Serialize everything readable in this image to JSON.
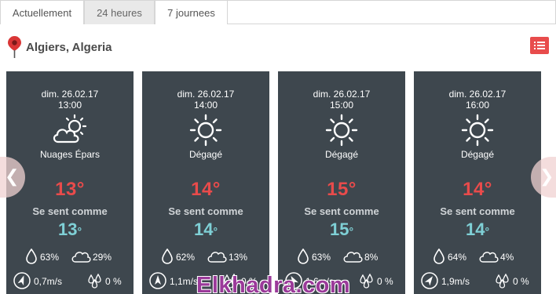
{
  "tabs": [
    {
      "label": "Actuellement"
    },
    {
      "label": "24 heures"
    },
    {
      "label": "7 journees"
    }
  ],
  "location": {
    "name": "Algiers, Algeria",
    "icon": "map-pin-icon"
  },
  "list_button": {
    "icon": "list-icon",
    "color": "#e84c4c"
  },
  "colors": {
    "card_bg": "#3e474e",
    "temp": "#e94b4b",
    "feels": "#7fd0d6"
  },
  "cards": [
    {
      "date": "dim. 26.02.17",
      "time": "13:00",
      "icon": "partly-cloudy-icon",
      "condition": "Nuages Épars",
      "temp": "13°",
      "feels_label": "Se sent comme",
      "feels_value": "13",
      "feels_unit": "°",
      "humidity": "63%",
      "clouds": "29%",
      "wind": "0,7m/s",
      "precip": "0 %"
    },
    {
      "date": "dim. 26.02.17",
      "time": "14:00",
      "icon": "sun-icon",
      "condition": "Dégagé",
      "temp": "14°",
      "feels_label": "Se sent comme",
      "feels_value": "14",
      "feels_unit": "°",
      "humidity": "62%",
      "clouds": "13%",
      "wind": "1,1m/s",
      "precip": "0 %"
    },
    {
      "date": "dim. 26.02.17",
      "time": "15:00",
      "icon": "sun-icon",
      "condition": "Dégagé",
      "temp": "15°",
      "feels_label": "Se sent comme",
      "feels_value": "15",
      "feels_unit": "°",
      "humidity": "63%",
      "clouds": "8%",
      "wind": "1,6m/s",
      "precip": "0 %"
    },
    {
      "date": "dim. 26.02.17",
      "time": "16:00",
      "icon": "sun-icon",
      "condition": "Dégagé",
      "temp": "14°",
      "feels_label": "Se sent comme",
      "feels_value": "14",
      "feels_unit": "°",
      "humidity": "64%",
      "clouds": "4%",
      "wind": "1,9m/s",
      "precip": "0 %"
    }
  ],
  "watermark": "Elkhadra.com"
}
